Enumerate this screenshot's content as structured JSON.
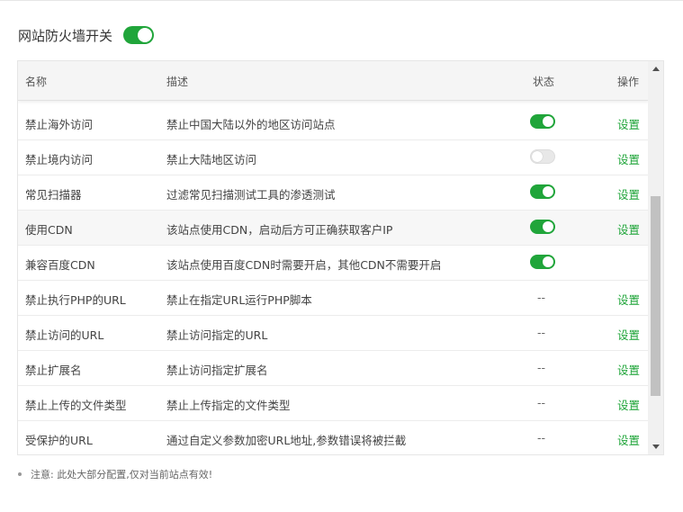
{
  "master_switch": {
    "label": "网站防火墙开关",
    "enabled": true
  },
  "table": {
    "headers": {
      "name": "名称",
      "desc": "描述",
      "status": "状态",
      "op": "操作"
    },
    "rows": [
      {
        "name": "禁止海外访问",
        "desc": "禁止中国大陆以外的地区访问站点",
        "status": "on",
        "op": "设置"
      },
      {
        "name": "禁止境内访问",
        "desc": "禁止大陆地区访问",
        "status": "off",
        "op": "设置"
      },
      {
        "name": "常见扫描器",
        "desc": "过滤常见扫描测试工具的渗透测试",
        "status": "on",
        "op": "设置"
      },
      {
        "name": "使用CDN",
        "desc": "该站点使用CDN，启动后方可正确获取客户IP",
        "status": "on",
        "op": "设置"
      },
      {
        "name": "兼容百度CDN",
        "desc": "该站点使用百度CDN时需要开启，其他CDN不需要开启",
        "status": "on",
        "op": ""
      },
      {
        "name": "禁止执行PHP的URL",
        "desc": "禁止在指定URL运行PHP脚本",
        "status": "--",
        "op": "设置"
      },
      {
        "name": "禁止访问的URL",
        "desc": "禁止访问指定的URL",
        "status": "--",
        "op": "设置"
      },
      {
        "name": "禁止扩展名",
        "desc": "禁止访问指定扩展名",
        "status": "--",
        "op": "设置"
      },
      {
        "name": "禁止上传的文件类型",
        "desc": "禁止上传指定的文件类型",
        "status": "--",
        "op": "设置"
      },
      {
        "name": "受保护的URL",
        "desc": "通过自定义参数加密URL地址,参数错误将被拦截",
        "status": "--",
        "op": "设置"
      }
    ]
  },
  "note": "注意: 此处大部分配置,仅对当前站点有效!",
  "colors": {
    "accent": "#20a53a",
    "toggle_off": "#e8e8e8"
  },
  "icons": {
    "scroll_up": "triangle-up",
    "scroll_down": "triangle-down"
  }
}
